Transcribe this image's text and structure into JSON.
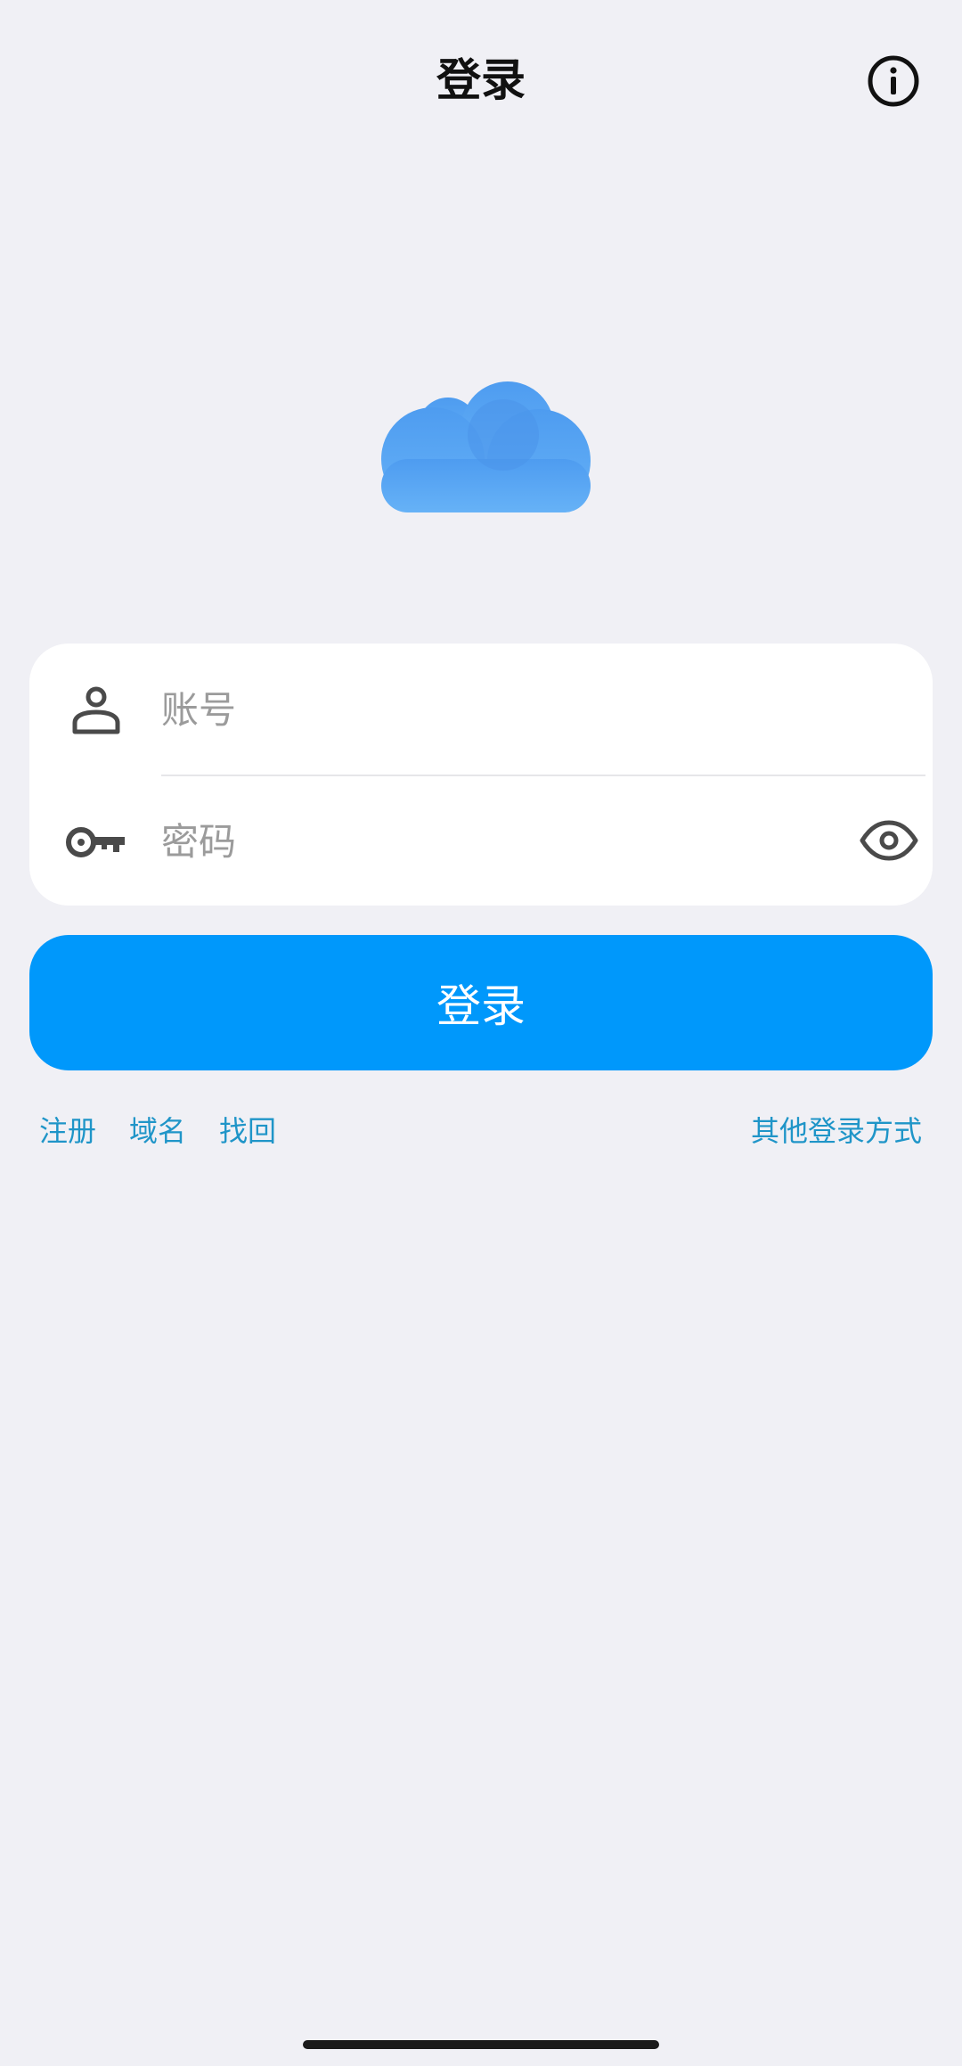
{
  "header": {
    "title": "登录",
    "info_icon": "info-circle-icon"
  },
  "logo": {
    "icon": "cloud-icon",
    "colors": {
      "primary": "#5aa9f2",
      "secondary": "#4e97ec"
    }
  },
  "form": {
    "account": {
      "icon": "user-icon",
      "placeholder": "账号",
      "value": ""
    },
    "password": {
      "icon": "key-icon",
      "placeholder": "密码",
      "value": "",
      "toggle_icon": "eye-icon"
    }
  },
  "login_button": {
    "label": "登录",
    "color": "#0098fb"
  },
  "links": {
    "register": "注册",
    "domain": "域名",
    "recover": "找回",
    "other_login": "其他登录方式",
    "color": "#1f95c8"
  },
  "colors": {
    "background": "#f0f0f5",
    "card": "#ffffff",
    "icon": "#4a4a4a"
  }
}
